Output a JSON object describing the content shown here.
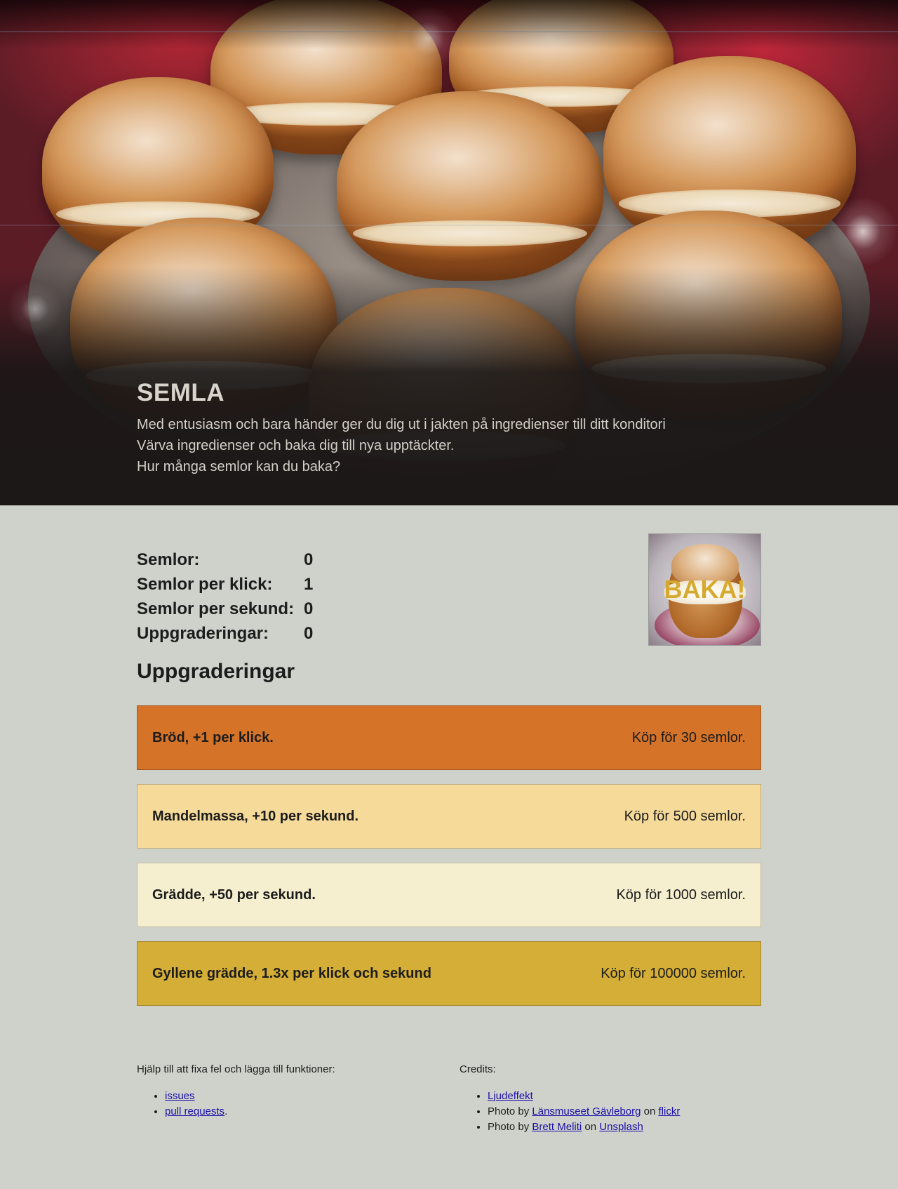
{
  "hero": {
    "title": "SEMLA",
    "lines": [
      "Med entusiasm och bara händer ger du dig ut i jakten på ingredienser till ditt konditori",
      "Värva ingredienser och baka dig till nya upptäckter.",
      "Hur många semlor kan du baka?"
    ]
  },
  "stats": [
    {
      "label": "Semlor:",
      "value": "0"
    },
    {
      "label": "Semlor per klick:",
      "value": "1"
    },
    {
      "label": "Semlor per sekund:",
      "value": "0"
    },
    {
      "label": "Uppgraderingar:",
      "value": "0"
    }
  ],
  "bake_button": {
    "label": "BAKA!"
  },
  "upgrades": {
    "title": "Uppgraderingar",
    "items": [
      {
        "name": "Bröd, +1 per klick.",
        "price": "Köp för 30 semlor.",
        "color": "#d57328"
      },
      {
        "name": "Mandelmassa, +10 per sekund.",
        "price": "Köp för 500 semlor.",
        "color": "#f5da9a"
      },
      {
        "name": "Grädde, +50 per sekund.",
        "price": "Köp för 1000 semlor.",
        "color": "#f6efcf"
      },
      {
        "name": "Gyllene grädde, 1.3x per klick och sekund",
        "price": "Köp för 100000 semlor.",
        "color": "#d4ae36"
      }
    ]
  },
  "footer": {
    "help": {
      "heading": "Hjälp till att fixa fel och lägga till funktioner:",
      "links": [
        "issues",
        "pull requests"
      ],
      "suffix": "."
    },
    "credits": {
      "heading": "Credits:",
      "sound_link": "Ljudeffekt",
      "photo_prefix": "Photo by",
      "on": "on",
      "photo1": {
        "author": "Länsmuseet Gävleborg",
        "site": "flickr"
      },
      "photo2": {
        "author": "Brett Meliti",
        "site": "Unsplash"
      }
    }
  }
}
